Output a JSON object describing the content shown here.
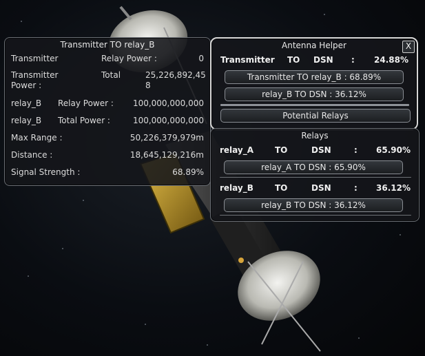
{
  "transmitter_panel": {
    "title": "Transmitter TO relay_B",
    "rows": [
      {
        "label": "Transmitter",
        "sub": "Relay Power :",
        "value": "0"
      },
      {
        "label": "Transmitter\nPower :",
        "sub": "Total",
        "value": "25,226,892,45\n8"
      },
      {
        "label": "relay_B",
        "sub": "Relay Power :",
        "value": "100,000,000,000"
      },
      {
        "label": "relay_B",
        "sub": "Total Power :",
        "value": "100,000,000,000"
      },
      {
        "label": "Max Range :",
        "sub": "",
        "value": "50,226,379,979m"
      },
      {
        "label": "Distance :",
        "sub": "",
        "value": "18,645,129,216m"
      },
      {
        "label": "Signal Strength :",
        "sub": "",
        "value": "68.89%"
      }
    ]
  },
  "antenna_helper": {
    "title": "Antenna Helper",
    "close": "X",
    "summary": {
      "a": "Transmitter",
      "to": "TO",
      "b": "DSN",
      "sep": ":",
      "pct": "24.88%"
    },
    "links": [
      "Transmitter TO relay_B : 68.89%",
      "relay_B TO DSN : 36.12%"
    ],
    "potential_button": "Potential Relays"
  },
  "relays": {
    "title": "Relays",
    "items": [
      {
        "name": "relay_A",
        "to": "TO",
        "dest": "DSN",
        "sep": ":",
        "pct": "65.90%",
        "link": "relay_A TO DSN : 65.90%"
      },
      {
        "name": "relay_B",
        "to": "TO",
        "dest": "DSN",
        "sep": ":",
        "pct": "36.12%",
        "link": "relay_B TO DSN : 36.12%"
      }
    ]
  }
}
